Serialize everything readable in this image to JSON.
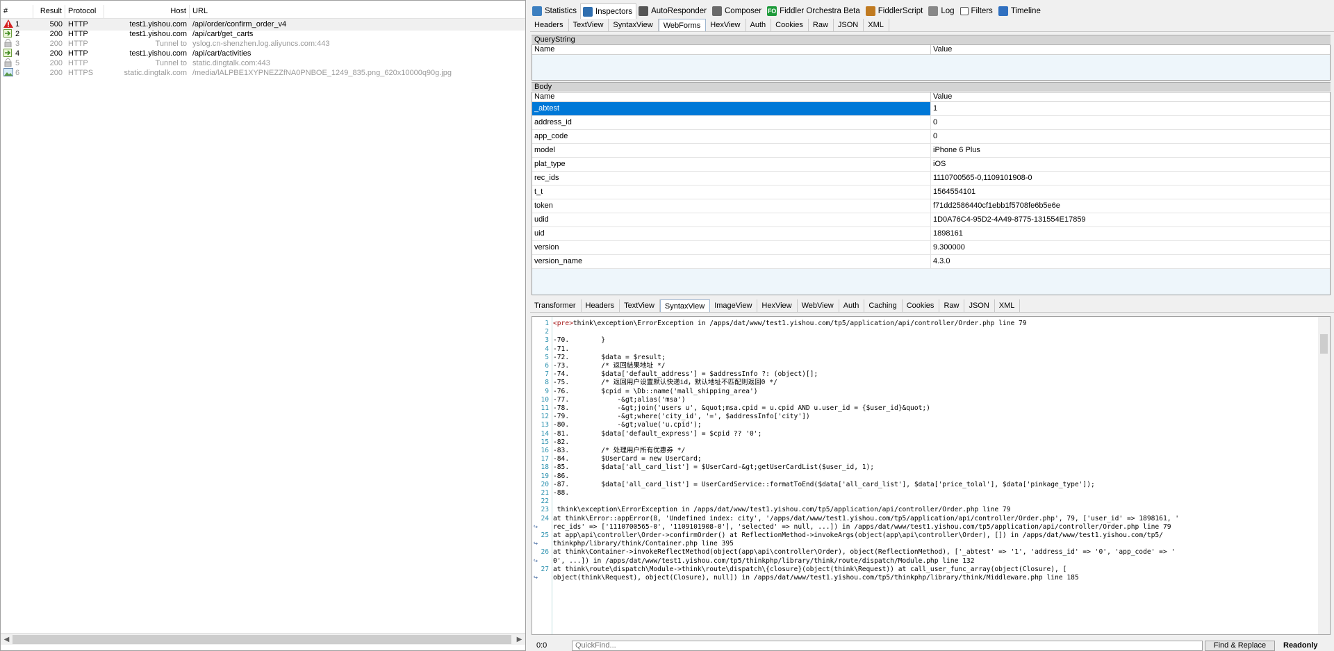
{
  "sessions": {
    "columns": [
      "#",
      "Result",
      "Protocol",
      "Host",
      "URL"
    ],
    "rows": [
      {
        "id": "1",
        "icon": "warning-icon",
        "result": "500",
        "protocol": "HTTP",
        "host": "test1.yishou.com",
        "url": "/api/order/confirm_order_v4",
        "dim": false
      },
      {
        "id": "2",
        "icon": "request-arrow-icon",
        "result": "200",
        "protocol": "HTTP",
        "host": "test1.yishou.com",
        "url": "/api/cart/get_carts",
        "dim": false
      },
      {
        "id": "3",
        "icon": "lock-icon",
        "result": "200",
        "protocol": "HTTP",
        "host": "Tunnel to",
        "url": "yslog.cn-shenzhen.log.aliyuncs.com:443",
        "dim": true
      },
      {
        "id": "4",
        "icon": "request-arrow-icon",
        "result": "200",
        "protocol": "HTTP",
        "host": "test1.yishou.com",
        "url": "/api/cart/activities",
        "dim": false
      },
      {
        "id": "5",
        "icon": "lock-icon",
        "result": "200",
        "protocol": "HTTP",
        "host": "Tunnel to",
        "url": "static.dingtalk.com:443",
        "dim": true
      },
      {
        "id": "6",
        "icon": "image-icon",
        "result": "200",
        "protocol": "HTTPS",
        "host": "static.dingtalk.com",
        "url": "/media/lALPBE1XYPNEZZfNA0PNBOE_1249_835.png_620x10000q90g.jpg",
        "dim": true
      }
    ]
  },
  "top_tabs": [
    {
      "label": "Statistics",
      "icon": "stopwatch-icon",
      "color": "#3c7fc0"
    },
    {
      "label": "Inspectors",
      "icon": "inspect-icon",
      "color": "#2f6fb0",
      "active": true
    },
    {
      "label": "AutoResponder",
      "icon": "lightning-icon",
      "color": "#555555"
    },
    {
      "label": "Composer",
      "icon": "composer-icon",
      "color": "#6a6a6a"
    },
    {
      "label": "Fiddler Orchestra Beta",
      "icon": "fo-icon",
      "color": "#1d9a3a",
      "glyph": "FO"
    },
    {
      "label": "FiddlerScript",
      "icon": "script-icon",
      "color": "#c07a20"
    },
    {
      "label": "Log",
      "icon": "log-icon",
      "color": "#888888"
    },
    {
      "label": "Filters",
      "icon": "checkbox-icon",
      "color": "#ffffff"
    },
    {
      "label": "Timeline",
      "icon": "timeline-icon",
      "color": "#3070c0"
    }
  ],
  "request_tabs": [
    "Headers",
    "TextView",
    "SyntaxView",
    "WebForms",
    "HexView",
    "Auth",
    "Cookies",
    "Raw",
    "JSON",
    "XML"
  ],
  "request_active": "WebForms",
  "querystring": {
    "title": "QueryString",
    "name_col": "Name",
    "value_col": "Value"
  },
  "body": {
    "title": "Body",
    "name_col": "Name",
    "value_col": "Value",
    "rows": [
      {
        "name": "_abtest",
        "value": "1"
      },
      {
        "name": "address_id",
        "value": "0"
      },
      {
        "name": "app_code",
        "value": "0"
      },
      {
        "name": "model",
        "value": "iPhone 6 Plus"
      },
      {
        "name": "plat_type",
        "value": "iOS"
      },
      {
        "name": "rec_ids",
        "value": "1110700565-0,1109101908-0"
      },
      {
        "name": "t_t",
        "value": "1564554101"
      },
      {
        "name": "token",
        "value": "f71dd2586440cf1ebb1f5708fe6b5e6e"
      },
      {
        "name": "udid",
        "value": "1D0A76C4-95D2-4A49-8775-131554E17859"
      },
      {
        "name": "uid",
        "value": "1898161"
      },
      {
        "name": "version",
        "value": "9.300000"
      },
      {
        "name": "version_name",
        "value": "4.3.0"
      }
    ]
  },
  "response_tabs": [
    "Transformer",
    "Headers",
    "TextView",
    "SyntaxView",
    "ImageView",
    "HexView",
    "WebView",
    "Auth",
    "Caching",
    "Cookies",
    "Raw",
    "JSON",
    "XML"
  ],
  "response_active": "SyntaxView",
  "code_lines": [
    {
      "n": "1",
      "tag": "<pre>",
      "t": "think\\exception\\ErrorException in /apps/dat/www/test1.yishou.com/tp5/application/api/controller/Order.php line 79"
    },
    {
      "n": "2",
      "t": ""
    },
    {
      "n": "3",
      "t": "-70.        }"
    },
    {
      "n": "4",
      "t": "-71."
    },
    {
      "n": "5",
      "t": "-72.        $data = $result;"
    },
    {
      "n": "6",
      "t": "-73.        /* 返回結果地址 */"
    },
    {
      "n": "7",
      "t": "-74.        $data['default_address'] = $addressInfo ?: (object)[];"
    },
    {
      "n": "8",
      "t": "-75.        /* 返回用户设置默认快递id，默认地址不匹配则返回0 */"
    },
    {
      "n": "9",
      "t": "-76.        $cpid = \\Db::name('mall_shipping_area')"
    },
    {
      "n": "10",
      "t": "-77.            -&gt;alias('msa')"
    },
    {
      "n": "11",
      "t": "-78.            -&gt;join('users u', &quot;msa.cpid = u.cpid AND u.user_id = {$user_id}&quot;)"
    },
    {
      "n": "12",
      "t": "-79.            -&gt;where('city_id', '=', $addressInfo['city'])"
    },
    {
      "n": "13",
      "t": "-80.            -&gt;value('u.cpid');"
    },
    {
      "n": "14",
      "t": "-81.        $data['default_express'] = $cpid ?? '0';"
    },
    {
      "n": "15",
      "t": "-82."
    },
    {
      "n": "16",
      "t": "-83.        /* 处理用户所有优惠券 */"
    },
    {
      "n": "17",
      "t": "-84.        $UserCard = new UserCard;"
    },
    {
      "n": "18",
      "t": "-85.        $data['all_card_list'] = $UserCard-&gt;getUserCardList($user_id, 1);"
    },
    {
      "n": "19",
      "t": "-86."
    },
    {
      "n": "20",
      "t": "-87.        $data['all_card_list'] = UserCardService::formatToEnd($data['all_card_list'], $data['price_tolal'], $data['pinkage_type']);"
    },
    {
      "n": "21",
      "t": "-88."
    },
    {
      "n": "22",
      "t": ""
    },
    {
      "n": "23",
      "t": " think\\exception\\ErrorException in /apps/dat/www/test1.yishou.com/tp5/application/api/controller/Order.php line 79"
    },
    {
      "n": "24",
      "t": "at think\\Error::appError(8, 'Undefined index: city', '/apps/dat/www/test1.yishou.com/tp5/application/api/controller/Order.php', 79, ['user_id' => 1898161, '"
    },
    {
      "n": "",
      "wrap": true,
      "t": "rec_ids' => ['1110700565-0', '1109101908-0'], 'selected' => null, ...]) in /apps/dat/www/test1.yishou.com/tp5/application/api/controller/Order.php line 79"
    },
    {
      "n": "25",
      "t": "at app\\api\\controller\\Order->confirmOrder() at ReflectionMethod->invokeArgs(object(app\\api\\controller\\Order), []) in /apps/dat/www/test1.yishou.com/tp5/"
    },
    {
      "n": "",
      "wrap": true,
      "t": "thinkphp/library/think/Container.php line 395"
    },
    {
      "n": "26",
      "t": "at think\\Container->invokeReflectMethod(object(app\\api\\controller\\Order), object(ReflectionMethod), ['_abtest' => '1', 'address_id' => '0', 'app_code' => '"
    },
    {
      "n": "",
      "wrap": true,
      "t": "0', ...]) in /apps/dat/www/test1.yishou.com/tp5/thinkphp/library/think/route/dispatch/Module.php line 132"
    },
    {
      "n": "27",
      "t": "at think\\route\\dispatch\\Module->think\\route\\dispatch\\{closure}(object(think\\Request)) at call_user_func_array(object(Closure), ["
    },
    {
      "n": "",
      "wrap": true,
      "t": "object(think\\Request), object(Closure), null]) in /apps/dat/www/test1.yishou.com/tp5/thinkphp/library/think/Middleware.php line 185"
    }
  ],
  "status": {
    "position": "0:0",
    "quickfind_placeholder": "QuickFind...",
    "find_button": "Find & Replace",
    "mode": "Readonly"
  }
}
